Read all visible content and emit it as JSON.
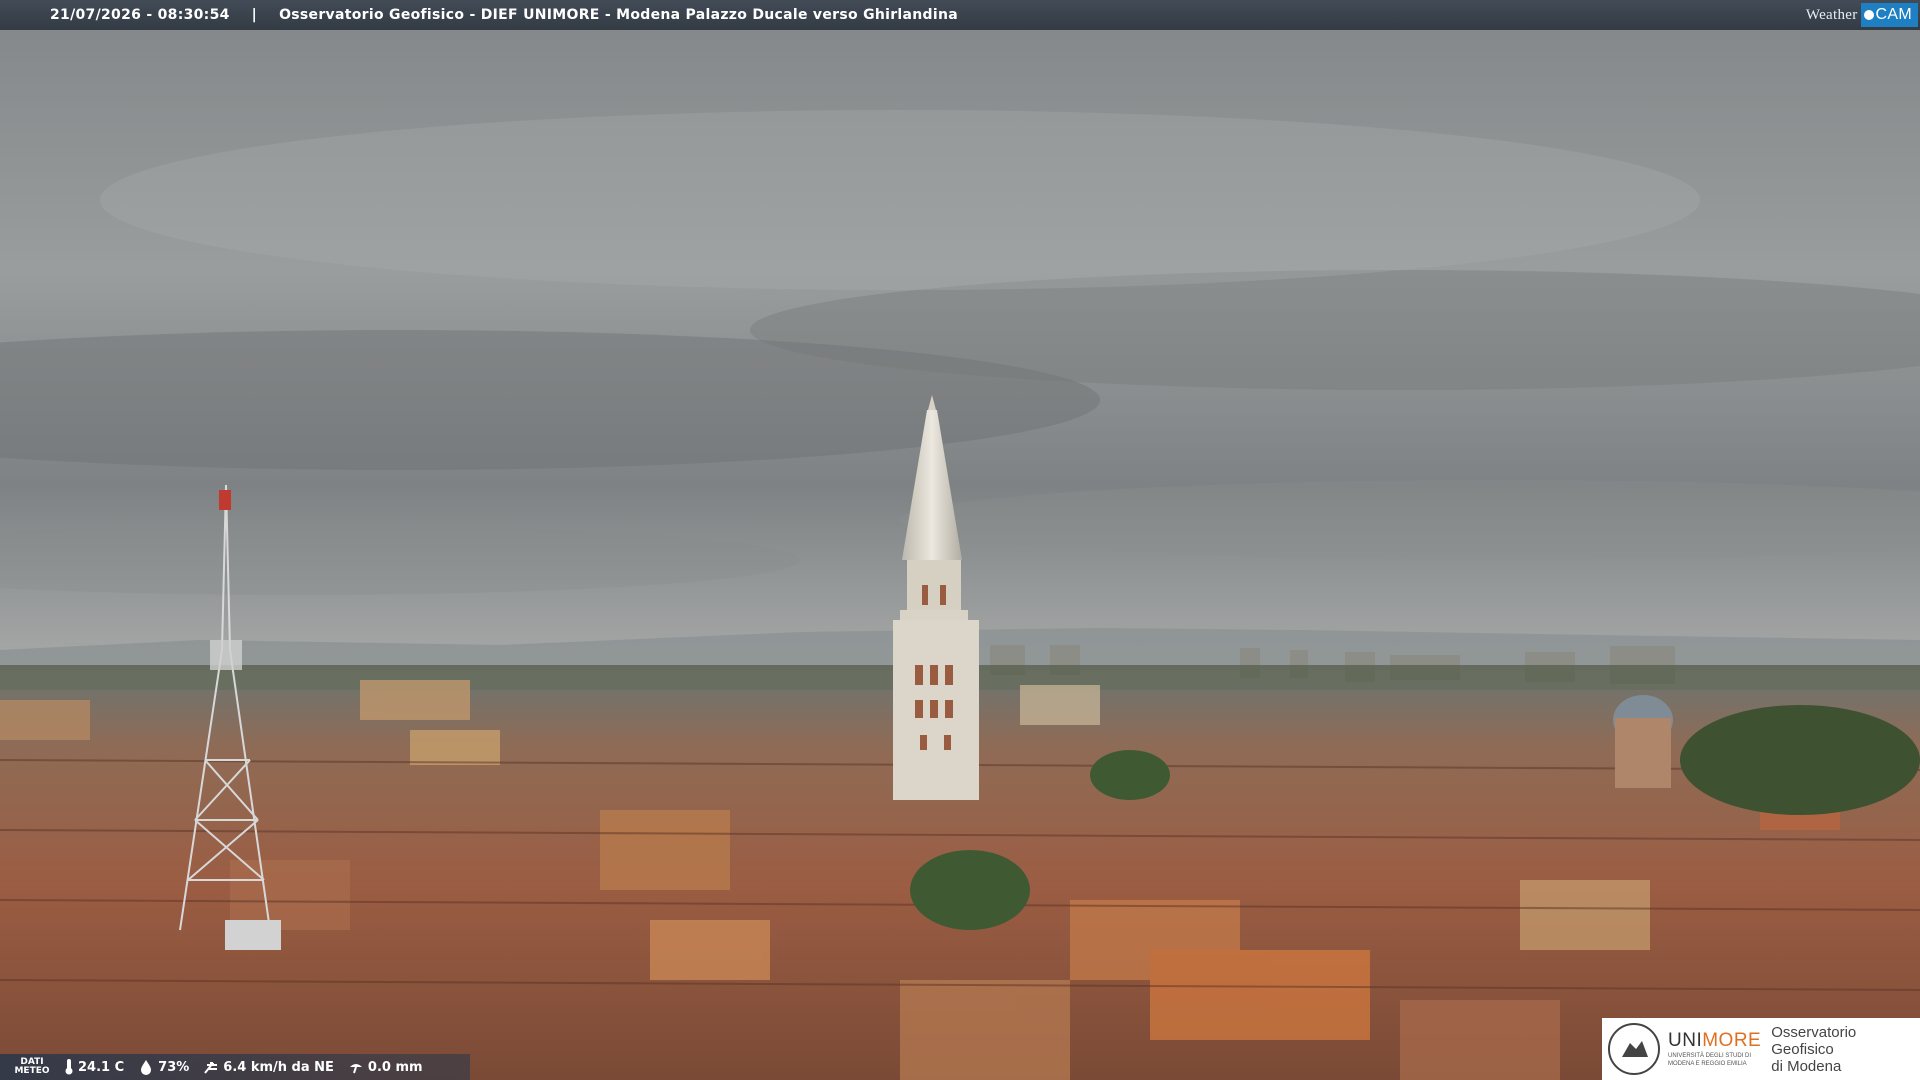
{
  "caption": {
    "datetime": "21/07/2026 - 08:30:54",
    "separator": "|",
    "title": "Osservatorio Geofisico - DIEF UNIMORE - Modena Palazzo Ducale verso Ghirlandina"
  },
  "brand": {
    "weather": "Weather",
    "cam": "CAM"
  },
  "weather_bar": {
    "label_line1": "DATI",
    "label_line2": "METEO",
    "temperature": "24.1 C",
    "humidity": "73%",
    "wind": "6.4 km/h da NE",
    "rain": "0.0 mm",
    "icons": [
      "thermometer-icon",
      "humidity-drop-icon",
      "wind-icon",
      "rain-gauge-icon"
    ]
  },
  "logo": {
    "uni_part1": "UNI",
    "uni_part2": "MORE",
    "uni_sub1": "UNIVERSITÀ DEGLI STUDI DI",
    "uni_sub2": "MODENA E REGGIO EMILIA",
    "obs_line1": "Osservatorio Geofisico",
    "obs_line2": "di Modena"
  },
  "colors": {
    "sky_top": "#8f9193",
    "sky_mid": "#b9bbbb",
    "horizon": "#c7c7c2",
    "roofs": "#9a5f45",
    "tower": "#d8d3c8",
    "accent_orange": "#e07020",
    "brand_blue": "#1e7fc2"
  }
}
